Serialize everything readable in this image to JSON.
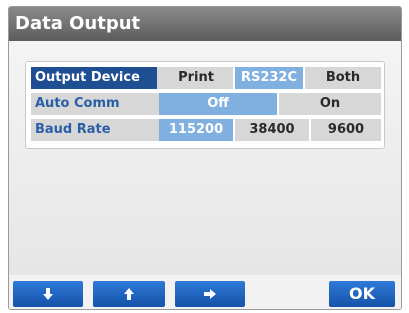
{
  "window": {
    "title": "Data Output"
  },
  "settings": {
    "output_device": {
      "label": "Output Device",
      "options": [
        "Print",
        "RS232C",
        "Both"
      ],
      "selected": "RS232C"
    },
    "auto_comm": {
      "label": "Auto Comm",
      "options": [
        "Off",
        "On"
      ],
      "selected": "Off"
    },
    "baud_rate": {
      "label": "Baud Rate",
      "options": [
        "115200",
        "38400",
        "9600"
      ],
      "selected": "115200"
    }
  },
  "buttons": {
    "down_icon": "arrow-down-icon",
    "up_icon": "arrow-up-icon",
    "right_icon": "arrow-right-icon",
    "ok_label": "OK"
  },
  "colors": {
    "accent": "#2f7ad8",
    "selected_row_label": "#1f4f93",
    "active_option": "#7fb0e0",
    "label_text": "#2a5fa8"
  }
}
